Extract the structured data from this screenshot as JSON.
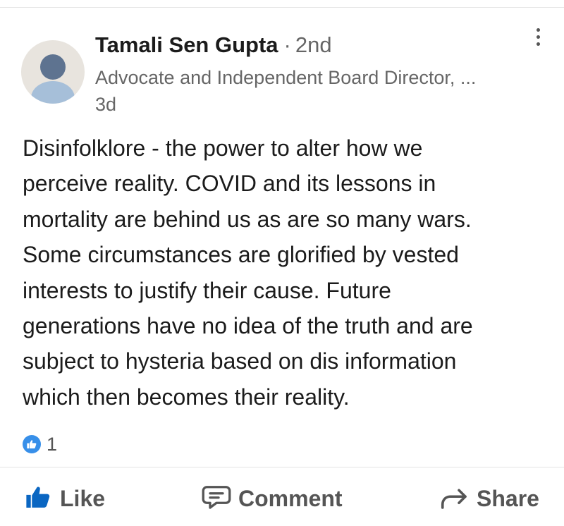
{
  "post": {
    "author": {
      "name": "Tamali Sen Gupta",
      "separator": "·",
      "degree": "2nd",
      "headline": "Advocate and Independent Board Director, ...",
      "timestamp": "3d"
    },
    "body_lines": [
      "Disinfolklore - the power to alter how we",
      "perceive reality. COVID and its lessons in",
      "mortality are behind us as are so many wars.",
      "Some circumstances are glorified by vested",
      "interests to justify their cause. Future",
      "generations have no idea of the truth and are",
      "subject to hysteria based on dis information",
      "which then becomes their reality."
    ],
    "reactions": {
      "count": "1",
      "icon": "like-reaction-icon"
    }
  },
  "actions": {
    "like": "Like",
    "comment": "Comment",
    "share": "Share"
  },
  "colors": {
    "accent_blue": "#378fe9",
    "like_icon_blue": "#0a66c2",
    "text_primary": "#1b1b1b",
    "text_secondary": "#666666"
  }
}
